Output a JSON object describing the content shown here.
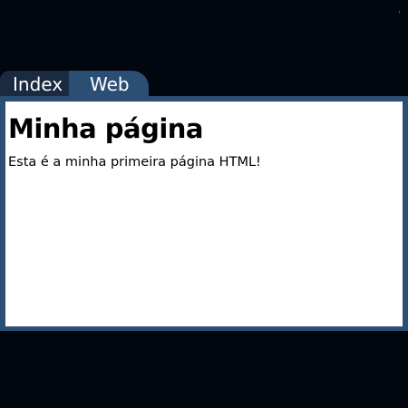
{
  "tabs": [
    {
      "label": "Index",
      "active": false
    },
    {
      "label": "Web",
      "active": true
    }
  ],
  "page": {
    "heading": "Minha página",
    "paragraph": "Esta é a minha primeira página HTML!"
  },
  "colors": {
    "background": "#02060f",
    "inactive_tab": "#1a2a40",
    "active_tab_and_frame": "#2b4e74",
    "viewport": "#ffffff",
    "text": "#000000"
  }
}
